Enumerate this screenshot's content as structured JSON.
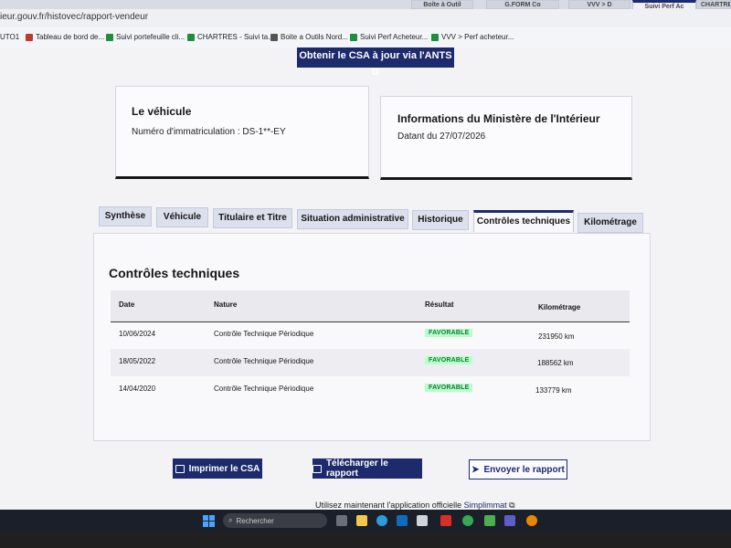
{
  "browser": {
    "tabs": [
      {
        "label": "Boîte à Outil"
      },
      {
        "label": "G.FORM Co"
      },
      {
        "label": "VVV > D"
      },
      {
        "label": "Suivi Perf Ac"
      },
      {
        "label": "CHARTRES"
      }
    ],
    "url": "ieur.gouv.fr/histovec/rapport-vendeur",
    "bookmarks": [
      {
        "label": "UTO1"
      },
      {
        "label": "Tableau de bord de..."
      },
      {
        "label": "Suivi portefeuille cli..."
      },
      {
        "label": "CHARTRES - Suivi ta..."
      },
      {
        "label": "Boite a Outils Nord..."
      },
      {
        "label": "Suivi Perf Acheteur..."
      },
      {
        "label": "VVV > Perf acheteur..."
      }
    ]
  },
  "top_button_label": "Obtenir le CSA à jour via l'ANTS",
  "vehicle_card": {
    "title": "Le véhicule",
    "plate_line": "Numéro d'immatriculation : DS-1**-EY"
  },
  "ministry_card": {
    "title": "Informations du Ministère de l'Intérieur",
    "date_line": "Datant du 27/07/2026"
  },
  "tabs": [
    {
      "label": "Synthèse"
    },
    {
      "label": "Véhicule"
    },
    {
      "label": "Titulaire et Titre"
    },
    {
      "label": "Situation administrative"
    },
    {
      "label": "Historique"
    },
    {
      "label": "Contrôles techniques"
    },
    {
      "label": "Kilométrage"
    }
  ],
  "active_tab": "Contrôles techniques",
  "section_title": "Contrôles techniques",
  "table": {
    "headers": [
      "Date",
      "Nature",
      "Résultat",
      "Kilométrage"
    ],
    "rows": [
      {
        "date": "10/06/2024",
        "nature": "Contrôle Technique Périodique",
        "result": "FAVORABLE",
        "km": "231950 km"
      },
      {
        "date": "18/05/2022",
        "nature": "Contrôle Technique Périodique",
        "result": "FAVORABLE",
        "km": "188562 km"
      },
      {
        "date": "14/04/2020",
        "nature": "Contrôle Technique Périodique",
        "result": "FAVORABLE",
        "km": "133779 km"
      }
    ]
  },
  "actions": {
    "print_label": "Imprimer le CSA",
    "download_label": "Télécharger le rapport",
    "send_label": "Envoyer le rapport"
  },
  "footer": {
    "text": "Utilisez maintenant l'application officielle ",
    "link": "Simplimmat"
  },
  "taskbar": {
    "search_placeholder": "Rechercher"
  },
  "colors": {
    "primary": "#1d2a6b",
    "badge_text": "#18753c",
    "badge_bg": "#b8fec9"
  }
}
